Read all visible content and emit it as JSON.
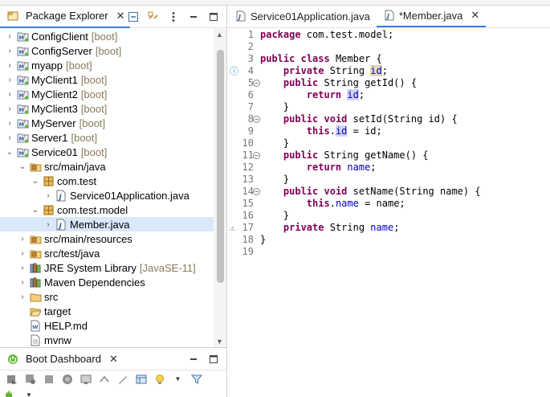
{
  "explorer": {
    "title": "Package Explorer",
    "close": "✕",
    "items": [
      {
        "label": "ConfigClient",
        "deco": "[boot]",
        "type": "project",
        "twisty": "›",
        "depth": 0
      },
      {
        "label": "ConfigServer",
        "deco": "[boot]",
        "type": "project",
        "twisty": "›",
        "depth": 0
      },
      {
        "label": "myapp",
        "deco": "[boot]",
        "type": "project",
        "twisty": "›",
        "depth": 0
      },
      {
        "label": "MyClient1",
        "deco": "[boot]",
        "type": "project",
        "twisty": "›",
        "depth": 0
      },
      {
        "label": "MyClient2",
        "deco": "[boot]",
        "type": "project",
        "twisty": "›",
        "depth": 0
      },
      {
        "label": "MyClient3",
        "deco": "[boot]",
        "type": "project",
        "twisty": "›",
        "depth": 0
      },
      {
        "label": "MyServer",
        "deco": "[boot]",
        "type": "project",
        "twisty": "›",
        "depth": 0
      },
      {
        "label": "Server1",
        "deco": "[boot]",
        "type": "project",
        "twisty": "›",
        "depth": 0
      },
      {
        "label": "Service01",
        "deco": "[boot]",
        "type": "project",
        "twisty": "⌄",
        "depth": 0
      },
      {
        "label": "src/main/java",
        "deco": "",
        "type": "srcfolder",
        "twisty": "⌄",
        "depth": 1
      },
      {
        "label": "com.test",
        "deco": "",
        "type": "package",
        "twisty": "⌄",
        "depth": 2
      },
      {
        "label": "Service01Application.java",
        "deco": "",
        "type": "java",
        "twisty": "›",
        "depth": 3
      },
      {
        "label": "com.test.model",
        "deco": "",
        "type": "package",
        "twisty": "⌄",
        "depth": 2
      },
      {
        "label": "Member.java",
        "deco": "",
        "type": "java",
        "twisty": "›",
        "depth": 3,
        "selected": true
      },
      {
        "label": "src/main/resources",
        "deco": "",
        "type": "srcfolder",
        "twisty": "›",
        "depth": 1
      },
      {
        "label": "src/test/java",
        "deco": "",
        "type": "srcfolder",
        "twisty": "›",
        "depth": 1
      },
      {
        "label": "JRE System Library",
        "deco": "[JavaSE-11]",
        "type": "library",
        "twisty": "›",
        "depth": 1
      },
      {
        "label": "Maven Dependencies",
        "deco": "",
        "type": "library",
        "twisty": "›",
        "depth": 1
      },
      {
        "label": "src",
        "deco": "",
        "type": "folder",
        "twisty": "›",
        "depth": 1
      },
      {
        "label": "target",
        "deco": "",
        "type": "folder-open",
        "twisty": "",
        "depth": 1
      },
      {
        "label": "HELP.md",
        "deco": "",
        "type": "file-w",
        "twisty": "",
        "depth": 1
      },
      {
        "label": "mvnw",
        "deco": "",
        "type": "file",
        "twisty": "",
        "depth": 1
      }
    ]
  },
  "boot_dashboard": {
    "title": "Boot Dashboard",
    "close": "✕"
  },
  "editor": {
    "tabs": [
      {
        "label": "Service01Application.java",
        "active": false,
        "close": ""
      },
      {
        "label": "*Member.java",
        "active": true,
        "close": "✕"
      }
    ],
    "lines": [
      {
        "n": "1",
        "html": "<span class='kw'>package</span> com.test.model;"
      },
      {
        "n": "2",
        "html": ""
      },
      {
        "n": "3",
        "html": "<span class='kw'>public</span> <span class='kw'>class</span> Member {"
      },
      {
        "n": "4",
        "html": "    <span class='kw'>private</span> String <span class='fld occw'>id</span>;",
        "mark": "ⓘ"
      },
      {
        "n": "5",
        "html": "    <span class='kw'>public</span> String getId() {",
        "fold": "−"
      },
      {
        "n": "6",
        "html": "        <span class='kw'>return</span> <span class='fld occ'>id</span>;"
      },
      {
        "n": "7",
        "html": "    }"
      },
      {
        "n": "8",
        "html": "    <span class='kw'>public</span> <span class='kw'>void</span> setId(String id) {",
        "fold": "−"
      },
      {
        "n": "9",
        "html": "        <span class='kw'>this</span>.<span class='fld occ'>id</span> = id;"
      },
      {
        "n": "10",
        "html": "    }"
      },
      {
        "n": "11",
        "html": "    <span class='kw'>public</span> String getName() {",
        "fold": "−"
      },
      {
        "n": "12",
        "html": "        <span class='kw'>return</span> <span class='fld'>name</span>;"
      },
      {
        "n": "13",
        "html": "    }"
      },
      {
        "n": "14",
        "html": "    <span class='kw'>public</span> <span class='kw'>void</span> setName(String name) {",
        "fold": "−"
      },
      {
        "n": "15",
        "html": "        <span class='kw'>this</span>.<span class='fld'>name</span> = name;"
      },
      {
        "n": "16",
        "html": "    }"
      },
      {
        "n": "17",
        "html": "    <span class='kw'>private</span> String <span class='fld'>name</span>;",
        "mark": "⚠"
      },
      {
        "n": "18",
        "html": "}"
      },
      {
        "n": "19",
        "html": ""
      }
    ]
  }
}
